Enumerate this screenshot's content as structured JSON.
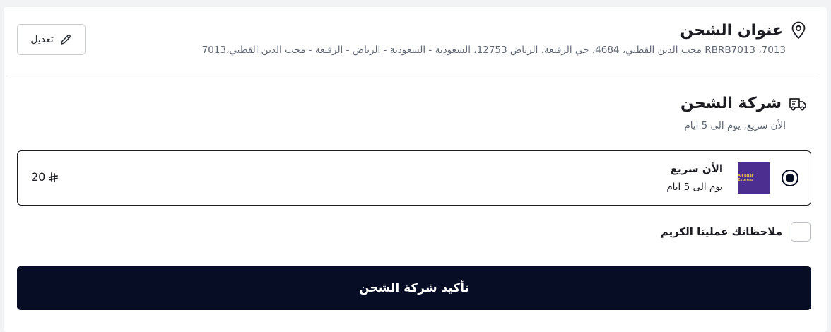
{
  "address": {
    "title": "عنوان الشحن",
    "text": "7013، RBRB7013 محب الدين القطبي، 4684، حي الرفيعة، الرياض 12753، السعودية - السعودية - الرياض - الرفيعة - محب الدين القطبي،7013",
    "edit_label": "تعديل",
    "icon": "location-pin-icon"
  },
  "shipping": {
    "title": "شركة الشحن",
    "subtitle": "الأن سريع, يوم الى 5 ايام",
    "icon": "delivery-truck-icon"
  },
  "option": {
    "name": "الأن سريع",
    "time": "يوم الى 5 ايام",
    "price": "20",
    "currency_symbol": "⃁",
    "logo_text": "Ali Bnar Express",
    "logo_color": "#4b2e8f",
    "selected": true
  },
  "notes": {
    "label": "ملاحظاتك عملينا الكريم",
    "checked": false
  },
  "confirm": {
    "label": "تأكيد شركة الشحن",
    "color": "#070d24"
  }
}
